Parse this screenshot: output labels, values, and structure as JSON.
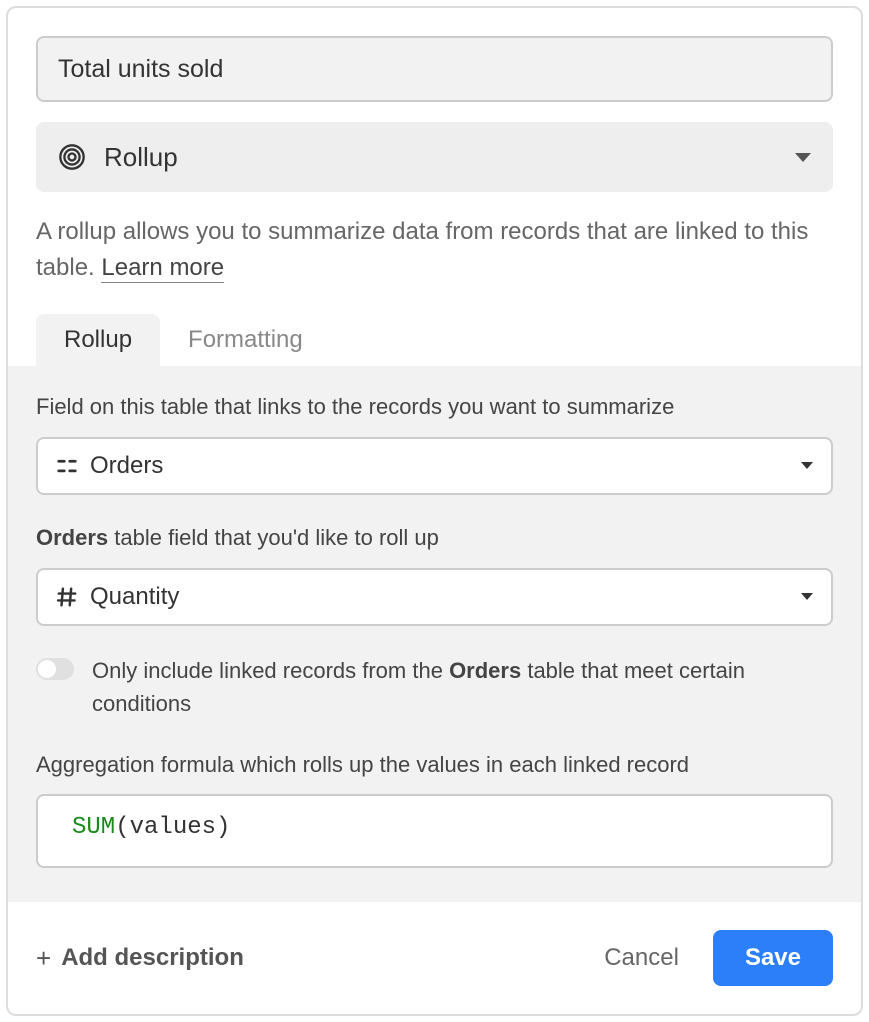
{
  "fieldName": "Total units sold",
  "fieldType": {
    "label": "Rollup"
  },
  "description": {
    "text": "A rollup allows you to summarize data from records that are linked to this table.",
    "learnMore": "Learn more"
  },
  "tabs": {
    "rollup": "Rollup",
    "formatting": "Formatting"
  },
  "config": {
    "linkFieldLabel": "Field on this table that links to the records you want to summarize",
    "linkFieldValue": "Orders",
    "rollupFieldLabelPrefix": "Orders",
    "rollupFieldLabelSuffix": " table field that you'd like to roll up",
    "rollupFieldValue": "Quantity",
    "filterPrefix": "Only include linked records from the ",
    "filterBold": "Orders",
    "filterSuffix": " table that meet certain conditions",
    "aggLabel": "Aggregation formula which rolls up the values in each linked record",
    "formula": {
      "func": "SUM",
      "rest": "(values)"
    }
  },
  "footer": {
    "addDescription": "Add description",
    "cancel": "Cancel",
    "save": "Save"
  }
}
